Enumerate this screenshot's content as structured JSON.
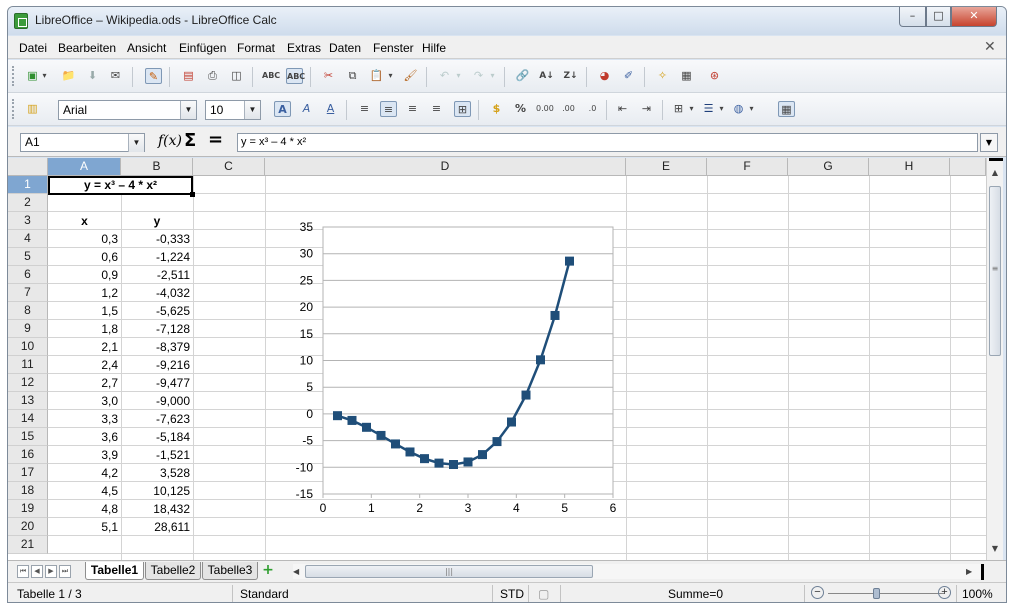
{
  "window": {
    "title": "LibreOffice – Wikipedia.ods - LibreOffice Calc",
    "minimize_label": "–",
    "maximize_label": "□",
    "close_label": "✕"
  },
  "menubar": {
    "items": [
      "Datei",
      "Bearbeiten",
      "Ansicht",
      "Einfügen",
      "Format",
      "Extras",
      "Daten",
      "Fenster",
      "Hilfe"
    ],
    "close_doc_label": "✕"
  },
  "toolbar_font": {
    "font_name": "Arial",
    "font_size": "10"
  },
  "formula_bar": {
    "name_box": "A1",
    "fx_label": "f(x)",
    "sum_label": "Σ",
    "equals_label": "=",
    "formula": "y = x³ – 4 * x²"
  },
  "grid": {
    "columns": [
      "A",
      "B",
      "C",
      "D",
      "E",
      "F",
      "G",
      "H"
    ],
    "rows": [
      "1",
      "2",
      "3",
      "4",
      "5",
      "6",
      "7",
      "8",
      "9",
      "10",
      "11",
      "12",
      "13",
      "14",
      "15",
      "16",
      "17",
      "18",
      "19",
      "20",
      "21"
    ],
    "a1_text": "y = x³ – 4 * x²",
    "header_x": "x",
    "header_y": "y",
    "x_values": [
      "0,3",
      "0,6",
      "0,9",
      "1,2",
      "1,5",
      "1,8",
      "2,1",
      "2,4",
      "2,7",
      "3,0",
      "3,3",
      "3,6",
      "3,9",
      "4,2",
      "4,5",
      "4,8",
      "5,1"
    ],
    "y_values": [
      "-0,333",
      "-1,224",
      "-2,511",
      "-4,032",
      "-5,625",
      "-7,128",
      "-8,379",
      "-9,216",
      "-9,477",
      "-9,000",
      "-7,623",
      "-5,184",
      "-1,521",
      "3,528",
      "10,125",
      "18,432",
      "28,611"
    ]
  },
  "chart_data": {
    "type": "line",
    "x": [
      0.3,
      0.6,
      0.9,
      1.2,
      1.5,
      1.8,
      2.1,
      2.4,
      2.7,
      3.0,
      3.3,
      3.6,
      3.9,
      4.2,
      4.5,
      4.8,
      5.1
    ],
    "series": [
      {
        "values": [
          -0.333,
          -1.224,
          -2.511,
          -4.032,
          -5.625,
          -7.128,
          -8.379,
          -9.216,
          -9.477,
          -9.0,
          -7.623,
          -5.184,
          -1.521,
          3.528,
          10.125,
          18.432,
          28.611
        ]
      }
    ],
    "xlim": [
      0,
      6
    ],
    "ylim": [
      -15,
      35
    ],
    "xticks": [
      "0",
      "1",
      "2",
      "3",
      "4",
      "5",
      "6"
    ],
    "yticks": [
      "-15",
      "-10",
      "-5",
      "0",
      "5",
      "10",
      "15",
      "20",
      "25",
      "30",
      "35"
    ],
    "grid": true,
    "marker": "square",
    "color": "#1f4e79"
  },
  "tabbar": {
    "nav": [
      "⏮",
      "◀",
      "▶",
      "⏭"
    ],
    "sheets": [
      "Tabelle1",
      "Tabelle2",
      "Tabelle3"
    ],
    "add_label": "+"
  },
  "statusbar": {
    "sheet_info": "Tabelle 1 / 3",
    "page_style": "Standard",
    "mode": "STD",
    "sum": "Summe=0",
    "zoom": "100%",
    "zoom_out": "−",
    "zoom_in": "+"
  },
  "colors": {
    "selection_header": "#7fa6d1",
    "series": "#1f4e79"
  }
}
